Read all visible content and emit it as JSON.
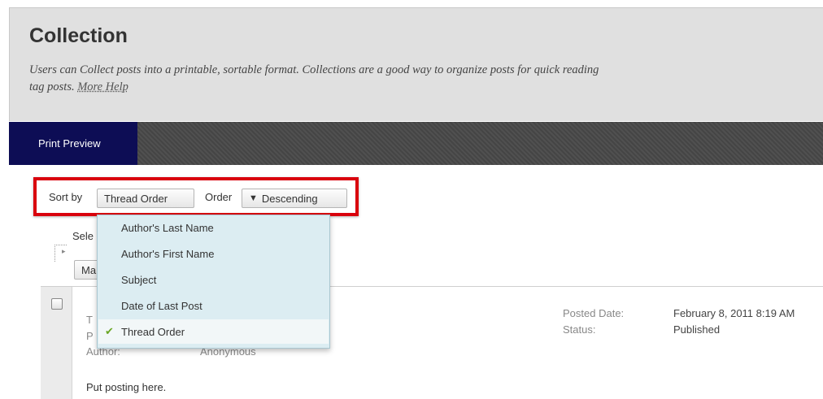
{
  "header": {
    "title": "Collection",
    "description_line1": "Users can Collect posts into a printable, sortable format. Collections are a good way to organize posts for quick reading",
    "description_line2": "tag posts.",
    "more_help": "More Help"
  },
  "actionbar": {
    "print_preview": "Print Preview"
  },
  "sortbar": {
    "sort_by_label": "Sort by",
    "sort_by_value": "Thread Order",
    "order_label": "Order",
    "order_value": "Descending",
    "order_arrow": "▼",
    "highlight_color": "#d9000d"
  },
  "dropdown": {
    "items": [
      "Author's Last Name",
      "Author's First Name",
      "Subject",
      "Date of Last Post",
      "Thread Order"
    ],
    "selected_index": 4,
    "selected_icon": "checkmark-icon"
  },
  "behind": {
    "select_label": "Sele",
    "mark_button": "Ma"
  },
  "post": {
    "row1_label_fragment": "T",
    "row2_label_fragment": "P",
    "author_label_fragment": "Author:",
    "author_value_fragment": "Anonymous",
    "posted_date_label": "Posted Date:",
    "posted_date_value": "February 8, 2011 8:19 AM",
    "status_label": "Status:",
    "status_value": "Published",
    "body": "Put posting here."
  }
}
